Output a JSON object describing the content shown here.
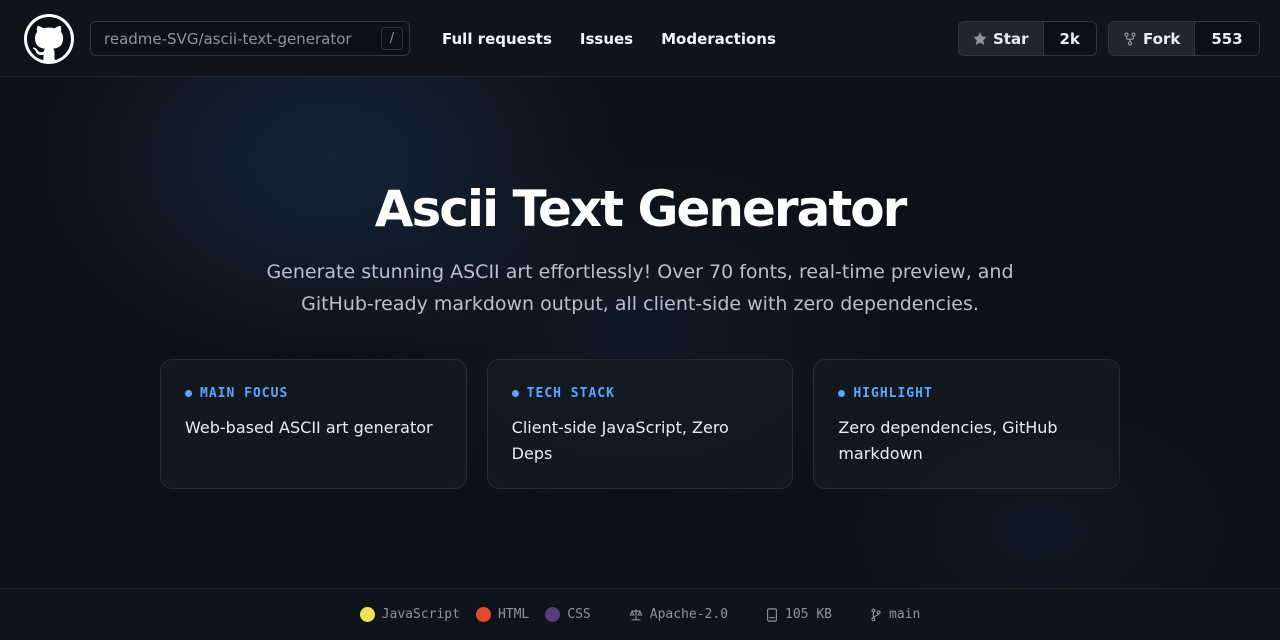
{
  "header": {
    "repo_path": "readme-SVG/ascii-text-generator",
    "shortcut_key": "/",
    "nav": [
      {
        "label": "Full requests"
      },
      {
        "label": "Issues"
      },
      {
        "label": "Moderactions"
      }
    ],
    "star": {
      "label": "Star",
      "count": "2k",
      "icon": "star-icon"
    },
    "fork": {
      "label": "Fork",
      "count": "553",
      "icon": "fork-icon"
    }
  },
  "hero": {
    "title": "Ascii Text Generator",
    "subtitle": "Generate stunning ASCII art effortlessly! Over 70 fonts, real-time preview, and GitHub-ready markdown output, all client-side with zero dependencies."
  },
  "cards": [
    {
      "label": "MAIN FOCUS",
      "text": "Web-based ASCII art generator"
    },
    {
      "label": "TECH STACK",
      "text": "Client-side JavaScript, Zero Deps"
    },
    {
      "label": "HIGHLIGHT",
      "text": "Zero dependencies, GitHub markdown"
    }
  ],
  "footer": {
    "languages": [
      {
        "name": "JavaScript",
        "color": "#f1e05a"
      },
      {
        "name": "HTML",
        "color": "#e34c26"
      },
      {
        "name": "CSS",
        "color": "#563d7c"
      }
    ],
    "license": "Apache-2.0",
    "size": "105 KB",
    "branch": "main"
  },
  "colors": {
    "background": "#0d1117",
    "accent": "#58a6ff"
  }
}
